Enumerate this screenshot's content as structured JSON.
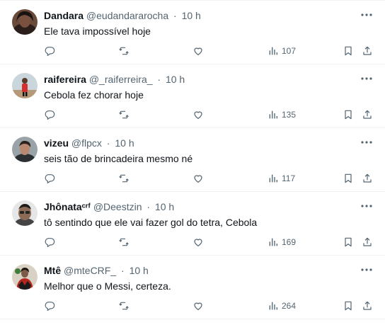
{
  "tweets": [
    {
      "name": "Dandara",
      "handle": "@eudandararocha",
      "separator": "·",
      "time": "10 h",
      "text": "Ele tava impossível hoje",
      "views": "107",
      "avatar_icon": "avatar-photo-dandara"
    },
    {
      "name": "raifereira",
      "handle": "@_raiferreira_",
      "separator": "·",
      "time": "10 h",
      "text": "Cebola fez chorar hoje",
      "views": "135",
      "avatar_icon": "avatar-photo-raifereira"
    },
    {
      "name": "vizeu",
      "handle": "@flpcx",
      "separator": "·",
      "time": "10 h",
      "text": "seis tão de brincadeira mesmo né",
      "views": "117",
      "avatar_icon": "avatar-photo-vizeu"
    },
    {
      "name": "Jhônataᶜʳᶠ",
      "handle": "@Deestzin",
      "separator": "·",
      "time": "10 h",
      "text": "tô sentindo que ele vai fazer gol do tetra, Cebola",
      "views": "169",
      "avatar_icon": "avatar-photo-jhonata"
    },
    {
      "name": "Mtê",
      "handle": "@mteCRF_",
      "separator": "·",
      "time": "10 h",
      "text": "Melhor que o Messi, certeza.",
      "views": "264",
      "avatar_icon": "avatar-photo-mte"
    }
  ],
  "icons": {
    "more": "more-icon",
    "reply": "reply-icon",
    "retweet": "retweet-icon",
    "like": "like-icon",
    "views": "views-icon",
    "bookmark": "bookmark-icon",
    "share": "share-icon"
  },
  "colors": {
    "text": "#0f1419",
    "secondary": "#536471",
    "border": "#eff3f4"
  }
}
